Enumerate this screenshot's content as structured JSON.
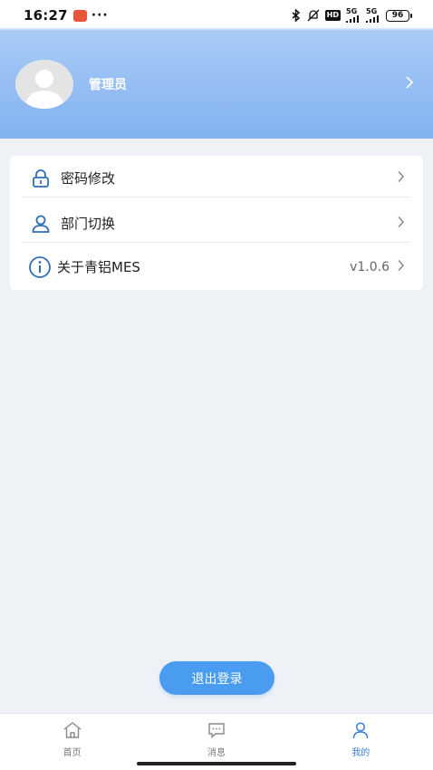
{
  "status_bar": {
    "time": "16:27",
    "dots": "···",
    "hd": "HD",
    "network1": "5G",
    "network2": "5G",
    "battery": "96"
  },
  "profile": {
    "name": "管理员"
  },
  "menu": {
    "items": [
      {
        "label": "密码修改",
        "icon": "lock-icon"
      },
      {
        "label": "部门切换",
        "icon": "user-icon"
      },
      {
        "label": "关于青铝MES",
        "icon": "info-icon",
        "value": "v1.0.6"
      }
    ]
  },
  "logout": {
    "label": "退出登录"
  },
  "nav": {
    "tabs": [
      {
        "label": "首页",
        "icon": "home-icon",
        "active": false
      },
      {
        "label": "消息",
        "icon": "message-icon",
        "active": false
      },
      {
        "label": "我的",
        "icon": "profile-icon",
        "active": true
      }
    ]
  },
  "colors": {
    "accent": "#4a9cf0",
    "header_gradient_top": "#a9cbf6",
    "header_gradient_bottom": "#82b2f1",
    "background": "#eef2f7",
    "active_tab": "#3b7fd8"
  }
}
